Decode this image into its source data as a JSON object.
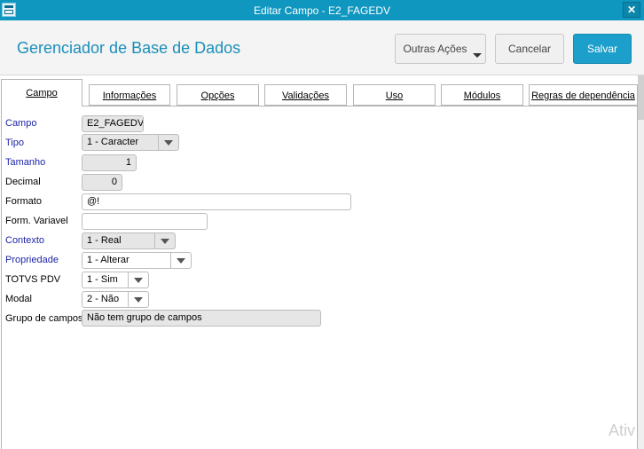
{
  "window": {
    "title": "Editar Campo - E2_FAGEDV",
    "close_glyph": "✕",
    "icon": "app-window-icon"
  },
  "header": {
    "title": "Gerenciador de Base de Dados",
    "buttons": {
      "outras": "Outras Ações",
      "cancelar": "Cancelar",
      "salvar": "Salvar"
    }
  },
  "tabs": [
    "Campo",
    "Informações",
    "Opções",
    "Validações",
    "Uso",
    "Módulos",
    "Regras de dependência"
  ],
  "active_tab": "Campo",
  "form": {
    "campo": {
      "label": "Campo",
      "value": "E2_FAGEDV"
    },
    "tipo": {
      "label": "Tipo",
      "value": "1 - Caracter"
    },
    "tamanho": {
      "label": "Tamanho",
      "value": "1"
    },
    "decimal": {
      "label": "Decimal",
      "value": "0"
    },
    "formato": {
      "label": "Formato",
      "value": "@!"
    },
    "form_variavel": {
      "label": "Form. Variavel",
      "value": ""
    },
    "contexto": {
      "label": "Contexto",
      "value": "1 - Real"
    },
    "propriedade": {
      "label": "Propriedade",
      "value": "1 - Alterar"
    },
    "totvs_pdv": {
      "label": "TOTVS PDV",
      "value": "1 - Sim"
    },
    "modal": {
      "label": "Modal",
      "value": "2 - Não"
    },
    "grupo": {
      "label": "Grupo de campos",
      "value": "Não tem grupo de campos"
    }
  },
  "watermark": "Ativ",
  "colors": {
    "titlebar": "#0f97c0",
    "accent": "#1d9fcb",
    "required_label": "#1c25a8",
    "app_title": "#1b8fb8"
  }
}
